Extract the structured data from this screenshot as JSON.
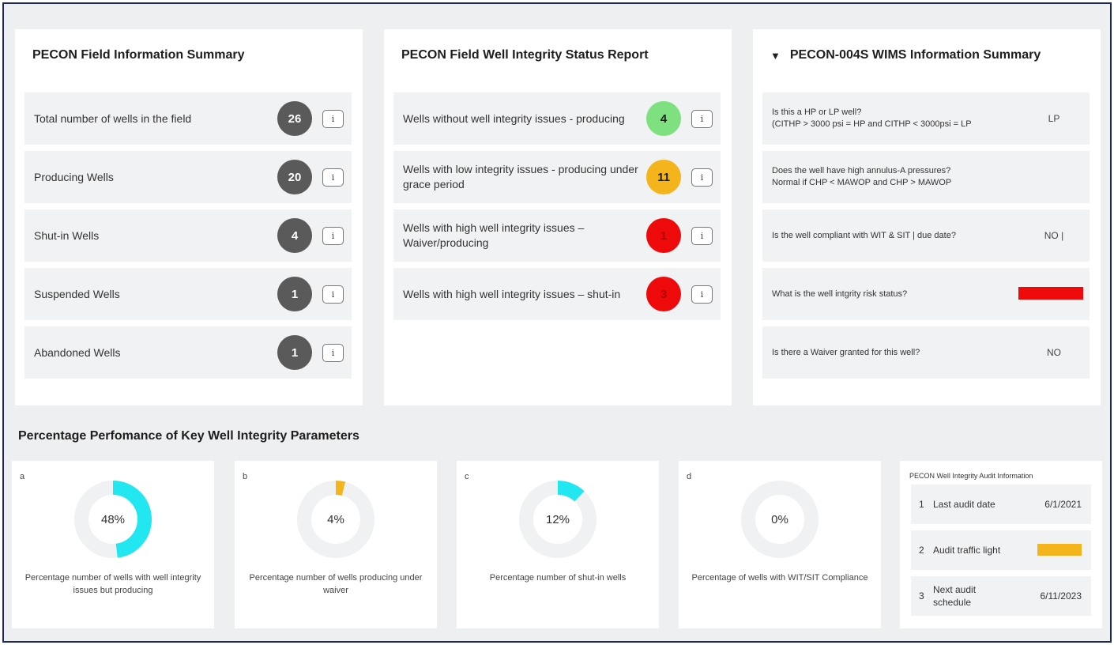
{
  "field_summary": {
    "title": "PECON Field Information Summary",
    "rows": [
      {
        "label": "Total number of wells in the field",
        "value": "26",
        "info": "i"
      },
      {
        "label": "Producing Wells",
        "value": "20",
        "info": "i"
      },
      {
        "label": "Shut-in Wells",
        "value": "4",
        "info": "i"
      },
      {
        "label": "Suspended Wells",
        "value": "1",
        "info": "i"
      },
      {
        "label": "Abandoned Wells",
        "value": "1",
        "info": "i"
      }
    ],
    "badge_color": "#5a5a5a"
  },
  "status_report": {
    "title": "PECON Field Well Integrity Status Report",
    "rows": [
      {
        "label": "Wells without well integrity issues - producing",
        "value": "4",
        "color": "#7ee07e",
        "info": "i"
      },
      {
        "label": "Wells with low integrity issues - producing under grace period",
        "value": "11",
        "color": "#f3b51b",
        "info": "i"
      },
      {
        "label": "Wells with high well integrity issues – Waiver/producing",
        "value": "1",
        "color": "#ee0a0a",
        "info": "i"
      },
      {
        "label": "Wells with high well integrity issues – shut-in",
        "value": "3",
        "color": "#ee0a0a",
        "info": "i"
      }
    ]
  },
  "wims_summary": {
    "collapse_glyph": "▼",
    "title": "PECON-004S WIMS Information Summary",
    "rows": [
      {
        "question": "Is this a HP or LP well?\n(CITHP > 3000 psi = HP and CITHP < 3000psi = LP",
        "answer": "LP"
      },
      {
        "question": "Does the well have high annulus-A pressures?\nNormal if CHP < MAWOP and CHP > MAWOP",
        "answer": ""
      },
      {
        "question": "Is the well compliant with WIT & SIT | due date?",
        "answer": "NO |"
      },
      {
        "question": "What is the well intgrity risk status?",
        "answer": "",
        "risk_color": "#ee0a0a"
      },
      {
        "question": "Is there a Waiver granted for this well?",
        "answer": "NO"
      }
    ]
  },
  "performance": {
    "title": "Percentage Perfomance of Key Well Integrity Parameters",
    "donuts": [
      {
        "letter": "a",
        "percent": 48,
        "label": "48%",
        "color": "#22e6f0",
        "caption": "Percentage number of wells with well integrity issues but producing"
      },
      {
        "letter": "b",
        "percent": 4,
        "label": "4%",
        "color": "#f3b51b",
        "caption": "Percentage number of wells producing under waiver"
      },
      {
        "letter": "c",
        "percent": 12,
        "label": "12%",
        "color": "#22e6f0",
        "caption": "Percentage number of shut-in wells"
      },
      {
        "letter": "d",
        "percent": 0,
        "label": "0%",
        "color": "#22e6f0",
        "caption": "Percentage of wells with WIT/SIT Compliance"
      }
    ],
    "track_color": "#f0f1f3"
  },
  "audit": {
    "title": "PECON Well Integrity Audit Information",
    "rows": [
      {
        "num": "1",
        "label": "Last audit date",
        "value": "6/1/2021"
      },
      {
        "num": "2",
        "label": "Audit traffic light",
        "value": "",
        "light_color": "#f3b51b"
      },
      {
        "num": "3",
        "label": "Next audit schedule",
        "value": "6/11/2023"
      }
    ]
  }
}
